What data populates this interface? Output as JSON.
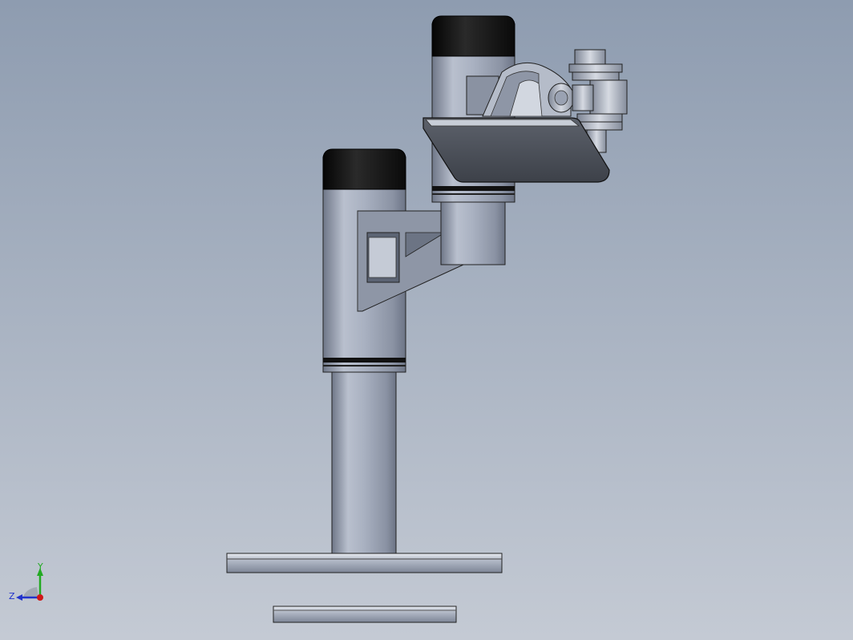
{
  "viewport": {
    "background_top": "#8e9cb0",
    "background_bottom": "#c4cad4"
  },
  "model": {
    "parts": [
      "lower-column",
      "upper-column",
      "base-plate",
      "bottom-disc",
      "support-arm",
      "mounting-plate",
      "hinge-bracket",
      "bolt-stack"
    ],
    "colors": {
      "steel": "#a5aebf",
      "cap": "#111111",
      "plate": "#4a4f58"
    }
  },
  "triad": {
    "y_label": "Y",
    "z_label": "Z",
    "y_color": "#22aa22",
    "x_color": "#d01818",
    "z_color": "#2233cc"
  }
}
